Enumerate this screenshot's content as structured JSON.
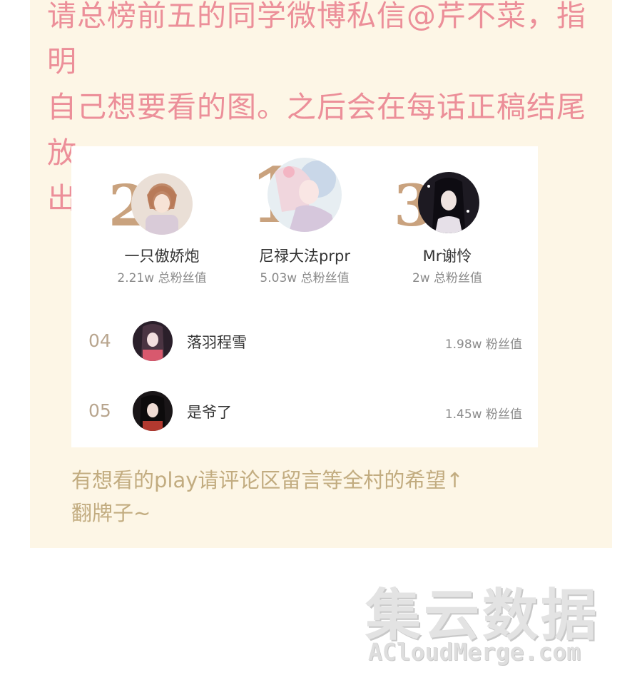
{
  "intro": {
    "line1": "请总榜前五的同学微博私信@芹不菜，指明",
    "line2": "自己想要看的图。之后会在每话正稿结尾放",
    "line3": "出。"
  },
  "top3": [
    {
      "rank": "1",
      "name": "尼禄大法prpr",
      "score": "5.03w 总粉丝值"
    },
    {
      "rank": "2",
      "name": "一只傲娇炮",
      "score": "2.21w 总粉丝值"
    },
    {
      "rank": "3",
      "name": "Mr谢怜",
      "score": "2w 总粉丝值"
    }
  ],
  "rows": [
    {
      "rank": "04",
      "name": "落羽程雪",
      "score": "1.98w 粉丝值"
    },
    {
      "rank": "05",
      "name": "是爷了",
      "score": "1.45w 粉丝值"
    }
  ],
  "footer": {
    "line1": "有想看的play请评论区留言等全村的希望↑",
    "line2": "翻牌子~"
  },
  "watermark": {
    "cn": "集云数据",
    "en": "ACloudMerge.com"
  },
  "colors": {
    "intro_text": "#ec8f99",
    "panel_bg": "#fdf6e6",
    "rank_gold": "#c9a27e",
    "footer_text": "#c2ac80"
  }
}
